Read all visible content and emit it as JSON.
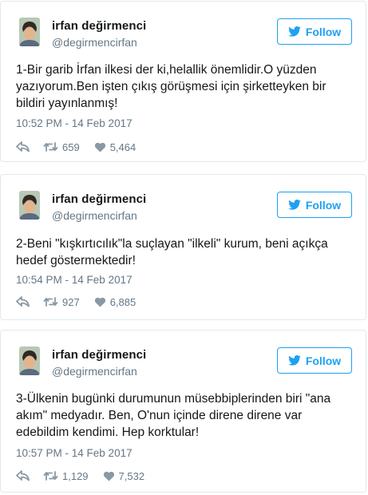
{
  "tweets": [
    {
      "name": "irfan değirmenci",
      "handle": "@degirmencirfan",
      "follow_label": "Follow",
      "text": "1-Bir garib İrfan ilkesi der ki,helallik önemlidir.O yüzden yazıyorum.Ben işten çıkış görüşmesi için şirketteyken bir bildiri yayınlanmış!",
      "time": "10:52 PM - 14 Feb 2017",
      "retweets": "659",
      "likes": "5,464"
    },
    {
      "name": "irfan değirmenci",
      "handle": "@degirmencirfan",
      "follow_label": "Follow",
      "text": "2-Beni \"kışkırtıcılık\"la suçlayan \"ilkeli\" kurum, beni açıkça hedef göstermektedir!",
      "time": "10:54 PM - 14 Feb 2017",
      "retweets": "927",
      "likes": "6,885"
    },
    {
      "name": "irfan değirmenci",
      "handle": "@degirmencirfan",
      "follow_label": "Follow",
      "text": "3-Ülkenin bugünki durumunun müsebbiplerinden biri \"ana akım\" medyadır. Ben, O'nun içinde direne direne var edebildim kendimi. Hep korktular!",
      "time": "10:57 PM - 14 Feb 2017",
      "retweets": "1,129",
      "likes": "7,532"
    }
  ],
  "icons": {
    "follow": "twitter-bird-icon",
    "reply": "reply-icon",
    "retweet": "retweet-icon",
    "like": "heart-icon"
  },
  "colors": {
    "accent": "#1da1f2",
    "muted": "#657786",
    "border": "#e1e8ed"
  }
}
